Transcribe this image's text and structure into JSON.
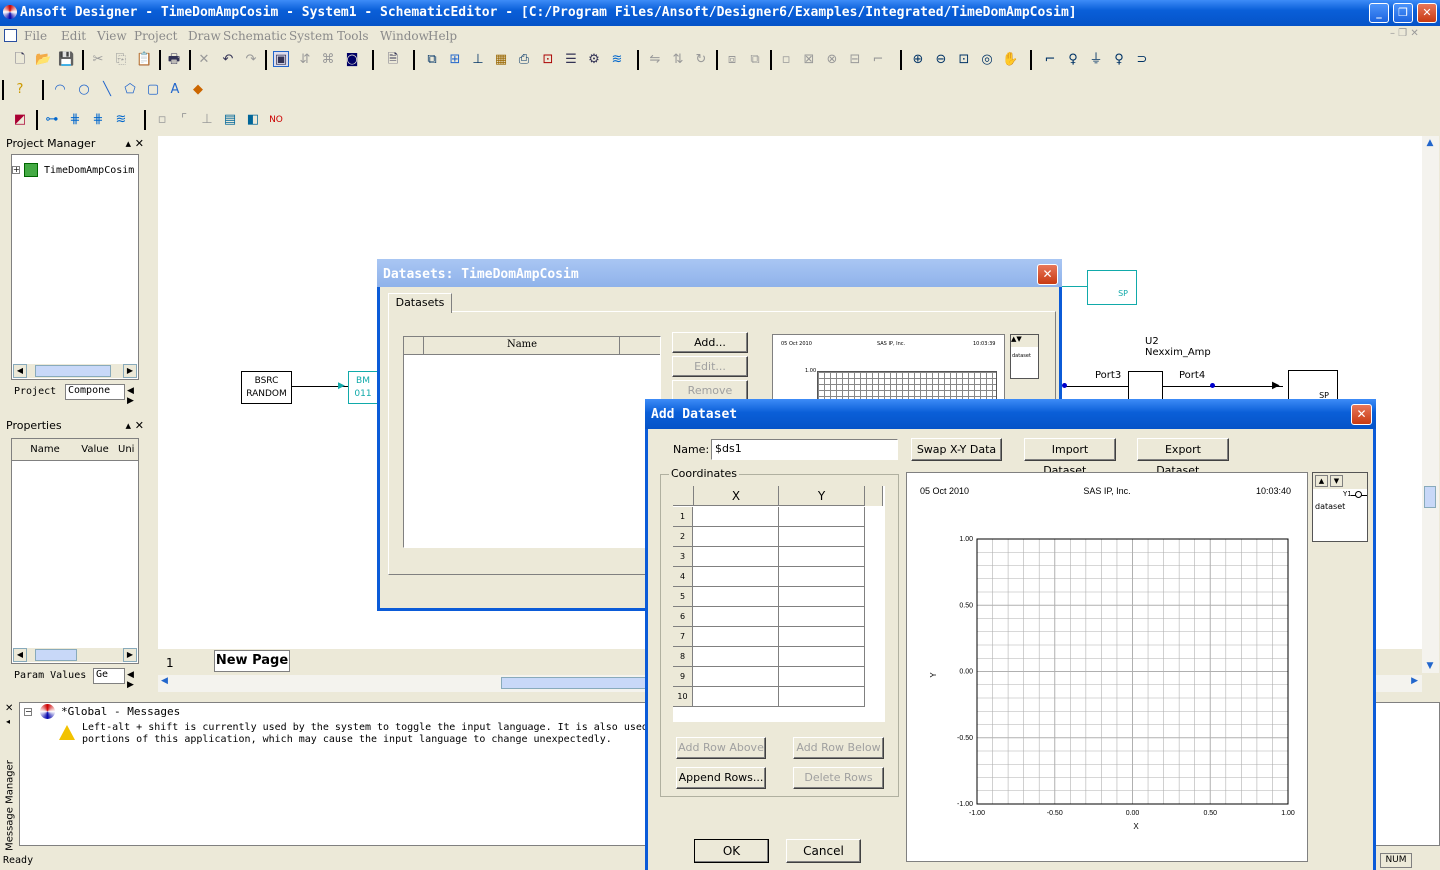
{
  "window": {
    "title": "Ansoft Designer - TimeDomAmpCosim - System1 - SchematicEditor - [C:/Program Files/Ansoft/Designer6/Examples/Integrated/TimeDomAmpCosim]"
  },
  "menu": [
    "File",
    "Edit",
    "View",
    "Project",
    "Draw",
    "Schematic",
    "System",
    "Tools",
    "Window",
    "Help"
  ],
  "project_manager": {
    "title": "Project Manager",
    "tree_item": "TimeDomAmpCosim",
    "tabs": [
      "Project",
      "Compone"
    ]
  },
  "properties": {
    "title": "Properties",
    "columns": [
      "Name",
      "Value",
      "Uni"
    ],
    "tabs": [
      "Param Values",
      "Ge"
    ]
  },
  "schematic": {
    "page_number": "1",
    "page_tab": "New Page",
    "components": {
      "bsrc": "BSRC\nRANDOM",
      "bm": "BM\n011",
      "sp_top": "SP",
      "u2_ref": "U2",
      "u2_name": "Nexxim_Amp",
      "port3": "Port3",
      "port4": "Port4",
      "sp_right": "SP"
    }
  },
  "messages": {
    "side_label": "Message Manager",
    "group": "*Global - Messages",
    "line1": "Left-alt + shift is currently used by the system to toggle the input language. It is also used",
    "line2": "portions of this application, which may cause the input language to change unexpectedly."
  },
  "status": {
    "text": "Ready",
    "num": "NUM"
  },
  "datasets_dialog": {
    "title": "Datasets: TimeDomAmpCosim",
    "tab": "Datasets",
    "column": "Name",
    "buttons": {
      "add": "Add...",
      "edit": "Edit...",
      "remove": "Remove"
    },
    "preview": {
      "date": "05 Oct 2010",
      "company": "SAS IP, Inc.",
      "time": "10:03:39",
      "ytop": "1.00",
      "legend": "dataset"
    }
  },
  "add_dataset": {
    "title": "Add Dataset",
    "name_label": "Name:",
    "name_value": "$ds1",
    "buttons": {
      "swap": "Swap X-Y Data",
      "import": "Import Dataset...",
      "export": "Export Dataset...",
      "add_row_above": "Add Row Above",
      "add_row_below": "Add Row Below",
      "append_rows": "Append Rows...",
      "delete_rows": "Delete Rows",
      "ok": "OK",
      "cancel": "Cancel"
    },
    "coordinates_label": "Coordinates",
    "columns": [
      "X",
      "Y"
    ],
    "rows": [
      "1",
      "2",
      "3",
      "4",
      "5",
      "6",
      "7",
      "8",
      "9",
      "10"
    ]
  },
  "chart_data": {
    "type": "line",
    "header_left": "05 Oct 2010",
    "header_center": "SAS IP, Inc.",
    "header_right": "10:03:40",
    "xlabel": "X",
    "ylabel": "Y",
    "xlim": [
      -1.0,
      1.0
    ],
    "ylim": [
      -1.0,
      1.0
    ],
    "xticks": [
      "-1.00",
      "-0.50",
      "0.00",
      "0.50",
      "1.00"
    ],
    "yticks": [
      "1.00",
      "0.50",
      "0.00",
      "-0.50",
      "-1.00"
    ],
    "grid": true,
    "legend": {
      "position": "right",
      "entries": [
        "dataset"
      ],
      "series_label": "Y1"
    },
    "series": []
  }
}
